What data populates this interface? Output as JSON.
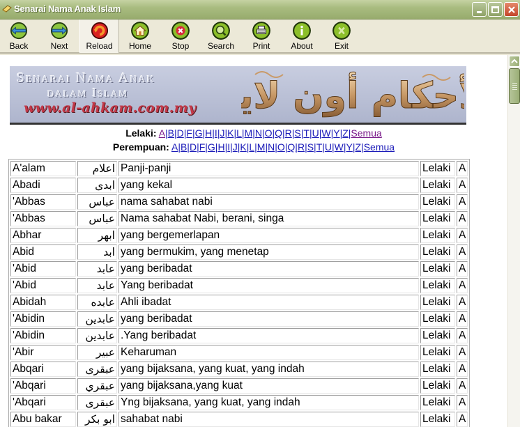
{
  "window": {
    "title": "Senarai Nama Anak Islam",
    "controls": {
      "minimize": "minimize",
      "maximize": "maximize",
      "close": "close"
    }
  },
  "toolbar": {
    "buttons": [
      {
        "label": "Back",
        "icon": "back-arrow-icon"
      },
      {
        "label": "Next",
        "icon": "next-arrow-icon"
      },
      {
        "label": "Reload",
        "icon": "reload-icon"
      },
      {
        "label": "Home",
        "icon": "home-icon"
      },
      {
        "label": "Stop",
        "icon": "stop-icon"
      },
      {
        "label": "Search",
        "icon": "search-icon"
      },
      {
        "label": "Print",
        "icon": "print-icon"
      },
      {
        "label": "About",
        "icon": "info-icon"
      },
      {
        "label": "Exit",
        "icon": "exit-icon"
      }
    ]
  },
  "banner": {
    "line1": "Senarai Nama Anak",
    "line2": "dalam Islam",
    "url": "www.al-ahkam.com.my",
    "calligraphy": "الأحكام أون لاين"
  },
  "nav": {
    "male_label": "Lelaki:",
    "female_label": "Perempuan:",
    "letters": [
      "A",
      "B",
      "D",
      "F",
      "G",
      "H",
      "I",
      "J",
      "K",
      "L",
      "M",
      "N",
      "O",
      "Q",
      "R",
      "S",
      "T",
      "U",
      "W",
      "Y",
      "Z"
    ],
    "all_label": "Semua"
  },
  "colors": {
    "link": "#1a1ab8",
    "visited_link": "#7a1a8a",
    "titlebar": "#a9bc80"
  },
  "table": {
    "rows": [
      {
        "name": "A'alam",
        "arabic": "اعلام",
        "meaning": "Panji-panji",
        "gender": "Lelaki",
        "letter": "A"
      },
      {
        "name": "Abadi",
        "arabic": "ابدى",
        "meaning": "yang kekal",
        "gender": "Lelaki",
        "letter": "A"
      },
      {
        "name": "'Abbas",
        "arabic": "عباس",
        "meaning": "nama sahabat nabi",
        "gender": "Lelaki",
        "letter": "A"
      },
      {
        "name": "'Abbas",
        "arabic": "عباس",
        "meaning": "Nama sahabat Nabi, berani, singa",
        "gender": "Lelaki",
        "letter": "A"
      },
      {
        "name": "Abhar",
        "arabic": "ابهر",
        "meaning": "yang bergemerlapan",
        "gender": "Lelaki",
        "letter": "A"
      },
      {
        "name": "Abid",
        "arabic": "ابد",
        "meaning": "yang bermukim, yang menetap",
        "gender": "Lelaki",
        "letter": "A"
      },
      {
        "name": "'Abid",
        "arabic": "عابد",
        "meaning": "yang beribadat",
        "gender": "Lelaki",
        "letter": "A"
      },
      {
        "name": "'Abid",
        "arabic": "عابد",
        "meaning": "Yang beribadat",
        "gender": "Lelaki",
        "letter": "A"
      },
      {
        "name": "Abidah",
        "arabic": "عابده",
        "meaning": "Ahli ibadat",
        "gender": "Lelaki",
        "letter": "A"
      },
      {
        "name": "'Abidin",
        "arabic": "عابدين",
        "meaning": "yang beribadat",
        "gender": "Lelaki",
        "letter": "A"
      },
      {
        "name": "'Abidin",
        "arabic": "عابدين",
        "meaning": ".Yang beribadat",
        "gender": "Lelaki",
        "letter": "A"
      },
      {
        "name": "'Abir",
        "arabic": "عبير",
        "meaning": "Keharuman",
        "gender": "Lelaki",
        "letter": "A"
      },
      {
        "name": "Abqari",
        "arabic": "عبقرى",
        "meaning": "yang bijaksana, yang kuat, yang indah",
        "gender": "Lelaki",
        "letter": "A"
      },
      {
        "name": "'Abqari",
        "arabic": "عبقري",
        "meaning": "yang bijaksana,yang kuat",
        "gender": "Lelaki",
        "letter": "A"
      },
      {
        "name": "'Abqari",
        "arabic": "عبقرى",
        "meaning": "Yng bijaksana, yang kuat, yang indah",
        "gender": "Lelaki",
        "letter": "A"
      },
      {
        "name": "Abu bakar",
        "arabic": "ابو بكر",
        "meaning": "sahabat nabi",
        "gender": "Lelaki",
        "letter": "A"
      }
    ]
  }
}
